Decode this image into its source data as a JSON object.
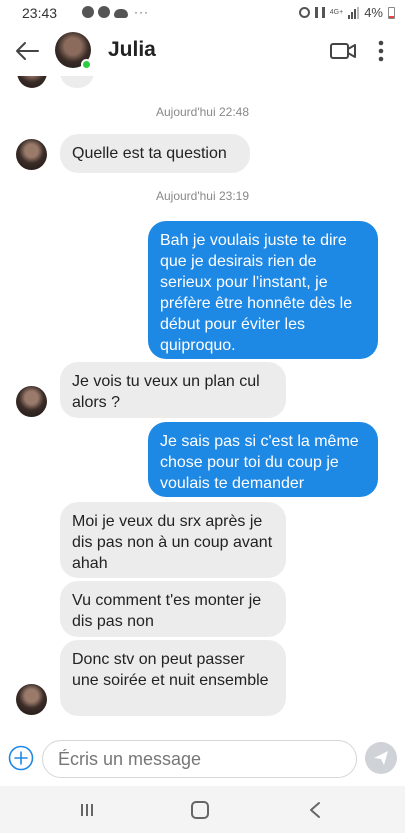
{
  "status_bar": {
    "time": "23:43",
    "more": "···",
    "lte": "4G+",
    "battery": "4%"
  },
  "contact": {
    "name": "Julia"
  },
  "conversation": {
    "timestamps": [
      "Aujourd'hui 22:48",
      "Aujourd'hui 23:19"
    ],
    "messages": [
      {
        "side": "in",
        "text": "Quelle est ta question"
      },
      {
        "side": "out",
        "text": "Bah je voulais juste te dire que je desirais rien de serieux pour l'instant, je préfère être honnête dès le début pour éviter les quiproquo."
      },
      {
        "side": "in",
        "text": "Je vois tu veux un plan cul alors ?"
      },
      {
        "side": "out",
        "text": "Je sais pas si c'est la même chose pour toi du coup je voulais te demander"
      },
      {
        "side": "in",
        "text": "Moi je veux du srx après je dis pas non à un coup avant ahah"
      },
      {
        "side": "in",
        "text": "Vu comment t'es monter je dis pas non"
      },
      {
        "side": "in",
        "text": "Donc stv on peut passer une soirée et nuit ensemble"
      }
    ]
  },
  "composer": {
    "placeholder": "Écris un message"
  },
  "colors": {
    "outgoing_bubble": "#1e88e5",
    "incoming_bubble": "#ececec",
    "online": "#2ecc40"
  }
}
